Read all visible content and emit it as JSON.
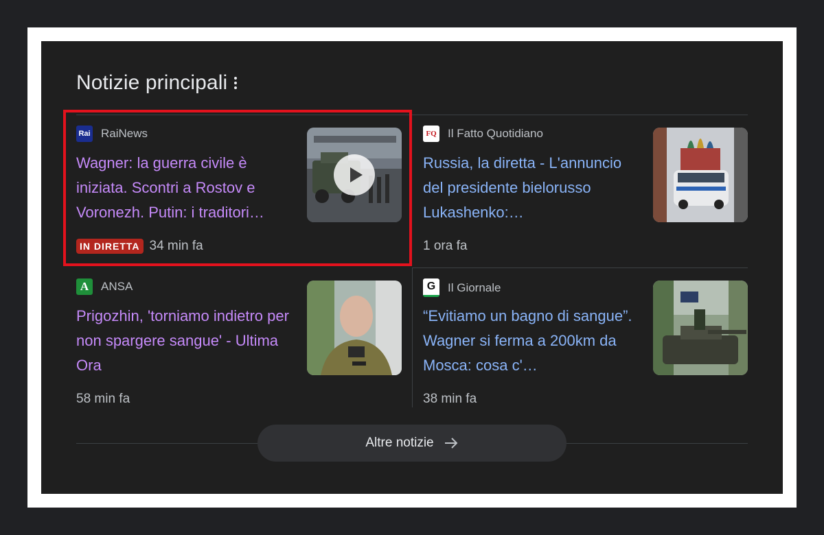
{
  "section": {
    "title": "Notizie principali"
  },
  "stories": [
    {
      "source": "RaiNews",
      "logo_text": "Rai",
      "title": "Wagner: la guerra civile è iniziata. Scontri a Rostov e Voronezh. Putin: i traditori…",
      "badge": "IN DIRETTA",
      "time": "34 min fa",
      "visited": true,
      "has_video": true
    },
    {
      "source": "Il Fatto Quotidiano",
      "logo_text": "FQ",
      "title": "Russia, la diretta - L'annuncio del presidente bielorusso Lukashenko:…",
      "time": "1 ora fa",
      "visited": false
    },
    {
      "source": "ANSA",
      "logo_text": "A",
      "title": "Prigozhin, 'torniamo indietro per non spargere sangue' - Ultima Ora",
      "time": "58 min fa",
      "visited": true
    },
    {
      "source": "Il Giornale",
      "logo_text": "G",
      "title": "“Evitiamo un bagno di sangue”. Wagner si ferma a 200km da Mosca: cosa c'…",
      "time": "38 min fa",
      "visited": false
    }
  ],
  "more_button": {
    "label": "Altre notizie"
  },
  "colors": {
    "visited_link": "#c58af9",
    "link": "#8ab4f8",
    "live_badge": "#b3261e",
    "highlight": "#e3121d"
  }
}
